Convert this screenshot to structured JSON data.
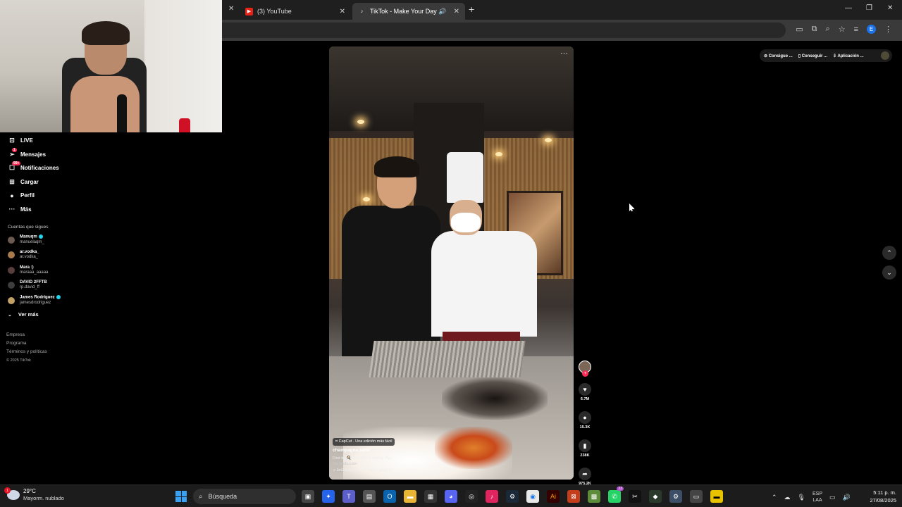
{
  "browser": {
    "tabs": [
      {
        "title": "(3) YouTube",
        "favicon": "youtube-icon"
      },
      {
        "title": "TikTok - Make Your Day",
        "favicon": "tiktok-icon",
        "active": true,
        "audio": true
      }
    ],
    "profile_initial": "E"
  },
  "sidebar": {
    "items": [
      {
        "label": "LIVE",
        "icon": "live-icon"
      },
      {
        "label": "Mensajes",
        "icon": "send-icon",
        "badge": "1"
      },
      {
        "label": "Notificaciones",
        "icon": "bell-icon",
        "badge": "99+"
      },
      {
        "label": "Cargar",
        "icon": "plus-square-icon"
      },
      {
        "label": "Perfil",
        "icon": "avatar-icon"
      },
      {
        "label": "Más",
        "icon": "more-icon"
      }
    ],
    "following_title": "Cuentas que sigues",
    "accounts": [
      {
        "name": "Manuqm",
        "handle": "manuelaqm_",
        "verified": true
      },
      {
        "name": "ar.vodka_",
        "handle": "ar.vodka_",
        "verified": false
      },
      {
        "name": "Mara :)",
        "handle": "maraaa_aaaaa",
        "verified": false
      },
      {
        "name": "DAVID 2FFTB",
        "handle": "rp.david_ff",
        "verified": false
      },
      {
        "name": "James Rodríguez",
        "handle": "jamesdrodriguez",
        "verified": true
      }
    ],
    "see_more": "Ver más",
    "footer": [
      "Empresa",
      "Programa",
      "Términos y políticas"
    ],
    "copyright": "© 2025 TikTok"
  },
  "video": {
    "capcut_label": "CapCut · Una edición más fácil",
    "username": "champagne.santi",
    "description": "First try 🍳 #hibachi #cooking #fyp",
    "translate": "Ver traducción",
    "music": "♫ Jet2 Advert · ♫ A7 (Mi) | MAN ia"
  },
  "actions": {
    "likes": "6.7M",
    "comments": "15.3K",
    "saves": "238K",
    "shares": "975.2K"
  },
  "top_right": {
    "pill1": "Consigue ...",
    "pill2": "Conseguir ...",
    "pill3": "Aplicación ..."
  },
  "taskbar": {
    "weather_badge": "1",
    "temperature": "29°C",
    "weather_desc": "Mayorm. nublado",
    "search_placeholder": "Búsqueda",
    "whatsapp_count": "23",
    "lang_top": "ESP",
    "lang_bottom": "LAA",
    "time": "5:11 p. m.",
    "date": "27/08/2025"
  }
}
